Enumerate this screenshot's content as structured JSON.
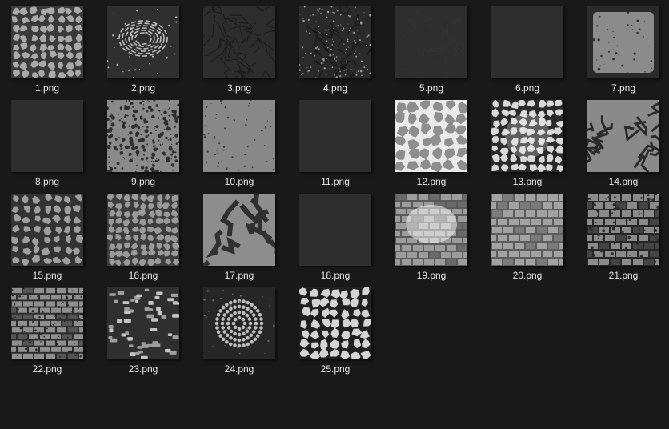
{
  "window": {
    "background": "#191919"
  },
  "files": [
    {
      "name": "1.png",
      "texture": "cracks-light"
    },
    {
      "name": "2.png",
      "texture": "ripple-ring"
    },
    {
      "name": "3.png",
      "texture": "dark-cracks"
    },
    {
      "name": "4.png",
      "texture": "dark-speckle"
    },
    {
      "name": "5.png",
      "texture": "faint-dark"
    },
    {
      "name": "6.png",
      "texture": "solid-dark"
    },
    {
      "name": "7.png",
      "texture": "gray-frame"
    },
    {
      "name": "8.png",
      "texture": "solid-dark"
    },
    {
      "name": "9.png",
      "texture": "blotch-mix"
    },
    {
      "name": "10.png",
      "texture": "gray-flecks"
    },
    {
      "name": "11.png",
      "texture": "solid-dark"
    },
    {
      "name": "12.png",
      "texture": "gray-cracks"
    },
    {
      "name": "13.png",
      "texture": "bright-cracks"
    },
    {
      "name": "14.png",
      "texture": "gray-veins"
    },
    {
      "name": "15.png",
      "texture": "patchy-cracks"
    },
    {
      "name": "16.png",
      "texture": "gray-cracks-fine"
    },
    {
      "name": "17.png",
      "texture": "rock-patches"
    },
    {
      "name": "18.png",
      "texture": "solid-dark"
    },
    {
      "name": "19.png",
      "texture": "brick-bright"
    },
    {
      "name": "20.png",
      "texture": "brick-gray"
    },
    {
      "name": "21.png",
      "texture": "brick-worn"
    },
    {
      "name": "22.png",
      "texture": "brick-noise"
    },
    {
      "name": "23.png",
      "texture": "cobble-scatter"
    },
    {
      "name": "24.png",
      "texture": "cobble-swirl"
    },
    {
      "name": "25.png",
      "texture": "cracks-white"
    }
  ]
}
